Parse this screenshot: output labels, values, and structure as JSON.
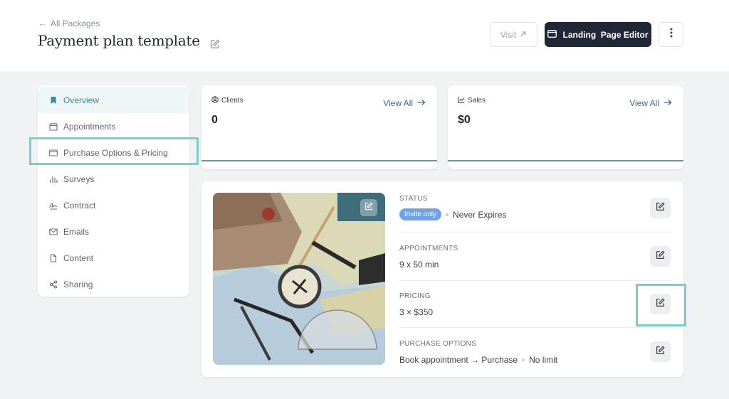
{
  "header": {
    "back_label": "All Packages",
    "title": "Payment plan template",
    "visit_label": "Visit",
    "landing_editor_label": "Landing  Page Editor"
  },
  "sidebar": {
    "items": [
      {
        "label": "Overview",
        "icon": "bookmark-icon",
        "active": true
      },
      {
        "label": "Appointments",
        "icon": "calendar-icon"
      },
      {
        "label": "Purchase Options & Pricing",
        "icon": "credit-card-icon"
      },
      {
        "label": "Surveys",
        "icon": "bar-chart-icon"
      },
      {
        "label": "Contract",
        "icon": "signature-icon"
      },
      {
        "label": "Emails",
        "icon": "mail-icon"
      },
      {
        "label": "Content",
        "icon": "file-icon"
      },
      {
        "label": "Sharing",
        "icon": "share-icon"
      }
    ]
  },
  "stats": {
    "clients": {
      "label": "Clients",
      "value": "0",
      "view_all": "View All"
    },
    "sales": {
      "label": "Sales",
      "value": "$0",
      "view_all": "View All"
    }
  },
  "package": {
    "status": {
      "label": "Status",
      "badge": "Invite only",
      "expiry": "Never Expires"
    },
    "appointments": {
      "label": "Appointments",
      "value": "9 x 50 min"
    },
    "pricing": {
      "label": "Pricing",
      "value": "3 × $350"
    },
    "purchase_options": {
      "label": "Purchase Options",
      "flow": "Book appointment → Purchase",
      "limit": "No limit"
    }
  },
  "colors": {
    "accent": "#3c8a9a",
    "dark_button": "#202837",
    "badge": "#6ea3ec",
    "highlight": "#79cfc8"
  }
}
